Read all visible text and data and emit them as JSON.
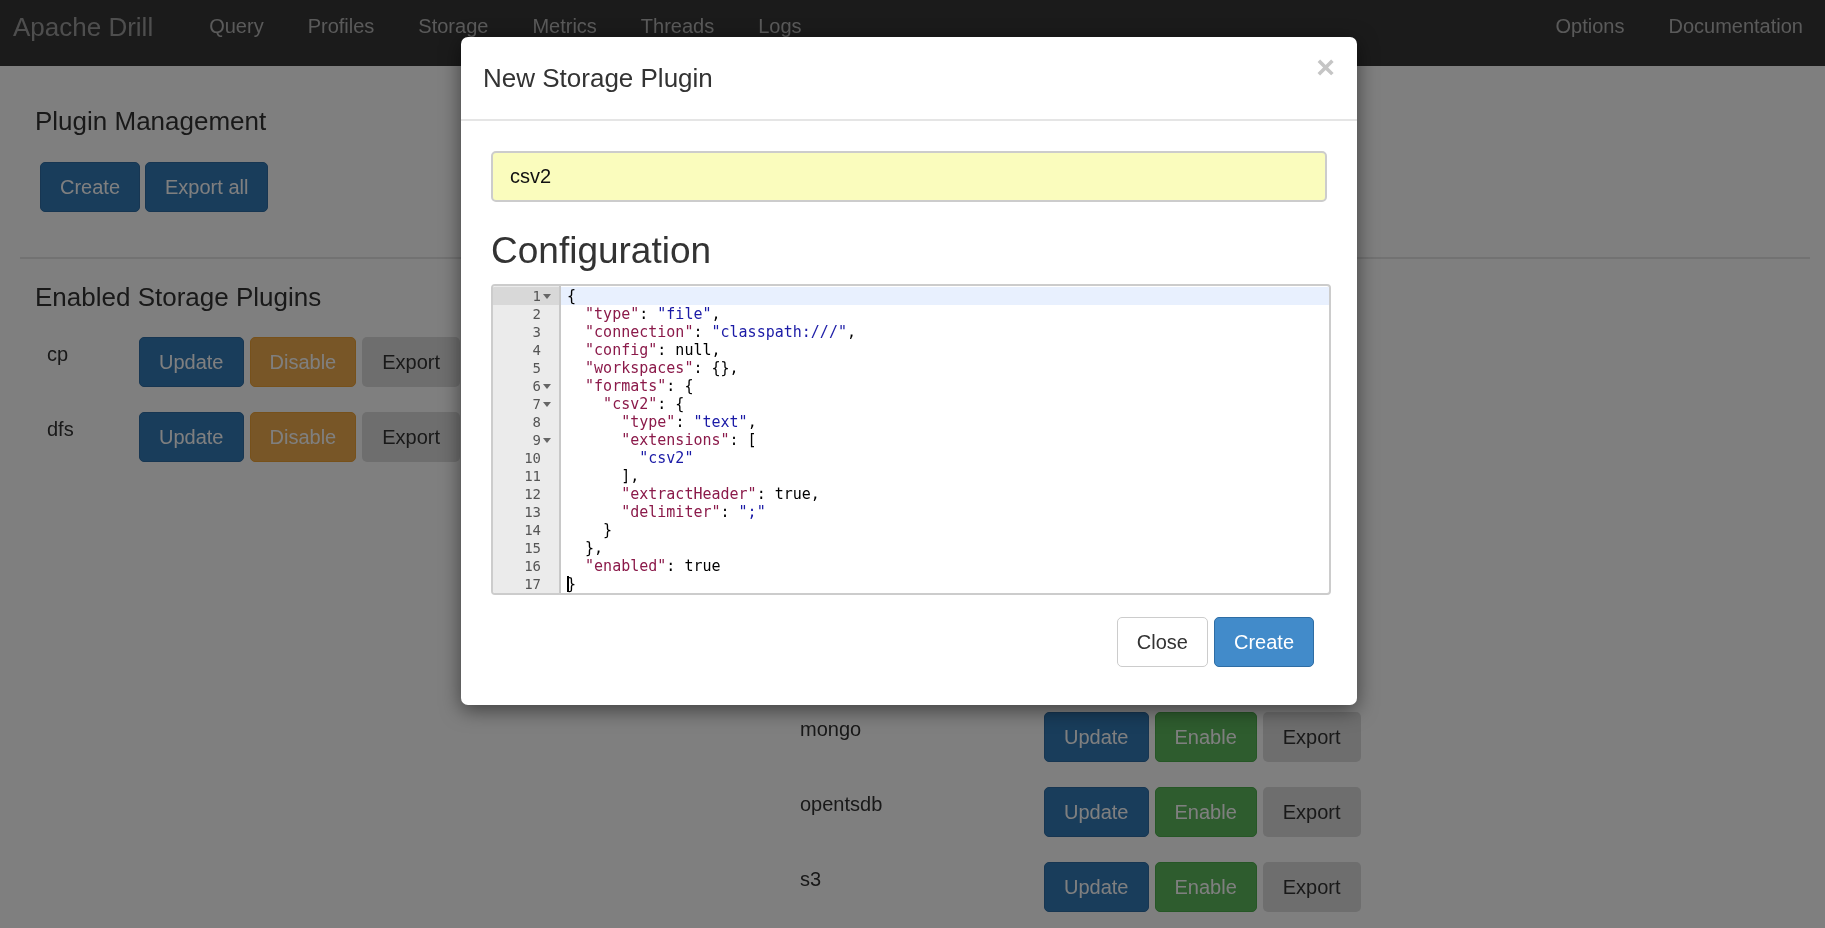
{
  "navbar": {
    "brand": "Apache Drill",
    "items": [
      "Query",
      "Profiles",
      "Storage",
      "Metrics",
      "Threads",
      "Logs"
    ],
    "right_items": [
      "Options",
      "Documentation"
    ]
  },
  "plugin_management": {
    "title": "Plugin Management",
    "buttons": [
      "Create",
      "Export all"
    ]
  },
  "enabled_plugins": {
    "title": "Enabled Storage Plugins",
    "rows": [
      {
        "name": "cp",
        "buttons": [
          {
            "kind": "update",
            "label": "Update"
          },
          {
            "kind": "disable",
            "label": "Disable"
          },
          {
            "kind": "export",
            "label": "Export"
          }
        ]
      },
      {
        "name": "dfs",
        "buttons": [
          {
            "kind": "update",
            "label": "Update"
          },
          {
            "kind": "disable",
            "label": "Disable"
          },
          {
            "kind": "export",
            "label": "Export"
          }
        ]
      }
    ]
  },
  "disabled_plugins": {
    "rows": [
      {
        "name": "mongo",
        "buttons": [
          {
            "kind": "update",
            "label": "Update"
          },
          {
            "kind": "enable",
            "label": "Enable"
          },
          {
            "kind": "export",
            "label": "Export"
          }
        ]
      },
      {
        "name": "opentsdb",
        "buttons": [
          {
            "kind": "update",
            "label": "Update"
          },
          {
            "kind": "enable",
            "label": "Enable"
          },
          {
            "kind": "export",
            "label": "Export"
          }
        ]
      },
      {
        "name": "s3",
        "buttons": [
          {
            "kind": "update",
            "label": "Update"
          },
          {
            "kind": "enable",
            "label": "Enable"
          },
          {
            "kind": "export",
            "label": "Export"
          }
        ]
      }
    ]
  },
  "modal": {
    "title": "New Storage Plugin",
    "close_icon": "×",
    "name_field": {
      "value": "csv2"
    },
    "config_title": "Configuration",
    "editor_lines": [
      {
        "number": "1",
        "foldable": true,
        "active": true,
        "cursor": false,
        "tokens": [
          {
            "kind": "plain",
            "text": "{"
          }
        ]
      },
      {
        "number": "2",
        "foldable": false,
        "active": false,
        "cursor": false,
        "tokens": [
          {
            "kind": "key",
            "text": "  \"type\""
          },
          {
            "kind": "plain",
            "text": ": "
          },
          {
            "kind": "string",
            "text": "\"file\""
          },
          {
            "kind": "plain",
            "text": ","
          }
        ]
      },
      {
        "number": "3",
        "foldable": false,
        "active": false,
        "cursor": false,
        "tokens": [
          {
            "kind": "key",
            "text": "  \"connection\""
          },
          {
            "kind": "plain",
            "text": ": "
          },
          {
            "kind": "string",
            "text": "\"classpath:///\""
          },
          {
            "kind": "plain",
            "text": ","
          }
        ]
      },
      {
        "number": "4",
        "foldable": false,
        "active": false,
        "cursor": false,
        "tokens": [
          {
            "kind": "key",
            "text": "  \"config\""
          },
          {
            "kind": "plain",
            "text": ": null,"
          }
        ]
      },
      {
        "number": "5",
        "foldable": false,
        "active": false,
        "cursor": false,
        "tokens": [
          {
            "kind": "key",
            "text": "  \"workspaces\""
          },
          {
            "kind": "plain",
            "text": ": {},"
          }
        ]
      },
      {
        "number": "6",
        "foldable": true,
        "active": false,
        "cursor": false,
        "tokens": [
          {
            "kind": "key",
            "text": "  \"formats\""
          },
          {
            "kind": "plain",
            "text": ": {"
          }
        ]
      },
      {
        "number": "7",
        "foldable": true,
        "active": false,
        "cursor": false,
        "tokens": [
          {
            "kind": "key",
            "text": "    \"csv2\""
          },
          {
            "kind": "plain",
            "text": ": {"
          }
        ]
      },
      {
        "number": "8",
        "foldable": false,
        "active": false,
        "cursor": false,
        "tokens": [
          {
            "kind": "key",
            "text": "      \"type\""
          },
          {
            "kind": "plain",
            "text": ": "
          },
          {
            "kind": "string",
            "text": "\"text\""
          },
          {
            "kind": "plain",
            "text": ","
          }
        ]
      },
      {
        "number": "9",
        "foldable": true,
        "active": false,
        "cursor": false,
        "tokens": [
          {
            "kind": "key",
            "text": "      \"extensions\""
          },
          {
            "kind": "plain",
            "text": ": ["
          }
        ]
      },
      {
        "number": "10",
        "foldable": false,
        "active": false,
        "cursor": false,
        "tokens": [
          {
            "kind": "string",
            "text": "        \"csv2\""
          }
        ]
      },
      {
        "number": "11",
        "foldable": false,
        "active": false,
        "cursor": false,
        "tokens": [
          {
            "kind": "plain",
            "text": "      ],"
          }
        ]
      },
      {
        "number": "12",
        "foldable": false,
        "active": false,
        "cursor": false,
        "tokens": [
          {
            "kind": "key",
            "text": "      \"extractHeader\""
          },
          {
            "kind": "plain",
            "text": ": true,"
          }
        ]
      },
      {
        "number": "13",
        "foldable": false,
        "active": false,
        "cursor": false,
        "tokens": [
          {
            "kind": "key",
            "text": "      \"delimiter\""
          },
          {
            "kind": "plain",
            "text": ": "
          },
          {
            "kind": "string",
            "text": "\";\""
          }
        ]
      },
      {
        "number": "14",
        "foldable": false,
        "active": false,
        "cursor": false,
        "tokens": [
          {
            "kind": "plain",
            "text": "    }"
          }
        ]
      },
      {
        "number": "15",
        "foldable": false,
        "active": false,
        "cursor": false,
        "tokens": [
          {
            "kind": "plain",
            "text": "  },"
          }
        ]
      },
      {
        "number": "16",
        "foldable": false,
        "active": false,
        "cursor": false,
        "tokens": [
          {
            "kind": "key",
            "text": "  \"enabled\""
          },
          {
            "kind": "plain",
            "text": ": true"
          }
        ]
      },
      {
        "number": "17",
        "foldable": false,
        "active": false,
        "cursor": true,
        "tokens": [
          {
            "kind": "plain",
            "text": "}"
          }
        ]
      }
    ],
    "buttons": [
      {
        "kind": "default",
        "label": "Close"
      },
      {
        "kind": "primary",
        "label": "Create"
      }
    ]
  }
}
